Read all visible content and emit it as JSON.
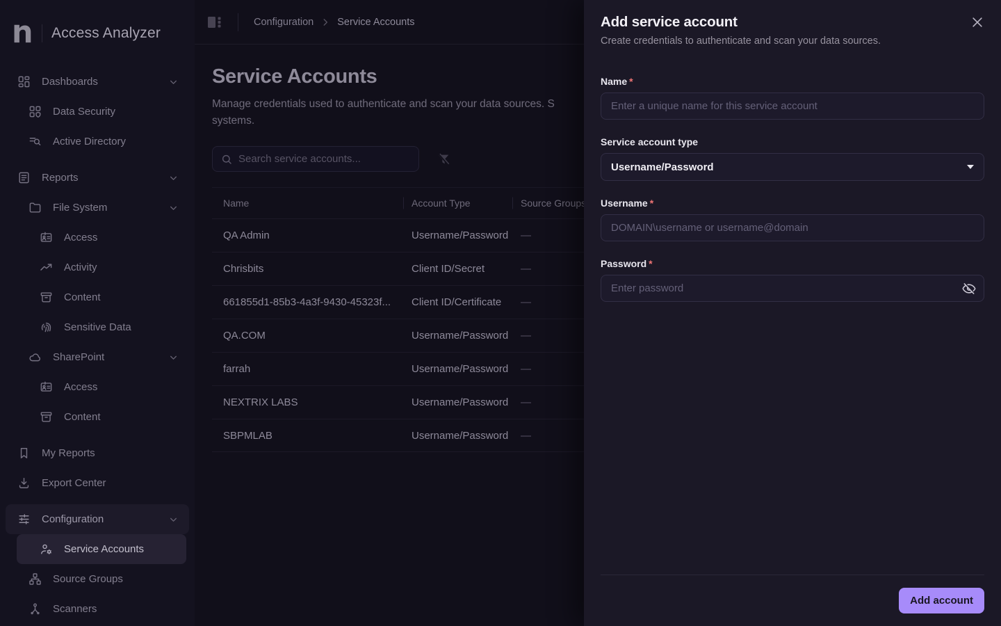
{
  "brand": {
    "name": "Access Analyzer"
  },
  "sidebar": {
    "items": [
      {
        "label": "Dashboards",
        "icon": "dashboard",
        "level": 0,
        "expandable": true
      },
      {
        "label": "Data Security",
        "icon": "data-security",
        "level": 1
      },
      {
        "label": "Active Directory",
        "icon": "active-directory",
        "level": 1
      },
      {
        "label": "Reports",
        "icon": "reports",
        "level": 0,
        "expandable": true,
        "gap": true
      },
      {
        "label": "File System",
        "icon": "folder",
        "level": 1,
        "expandable": true
      },
      {
        "label": "Access",
        "icon": "badge",
        "level": 2
      },
      {
        "label": "Activity",
        "icon": "activity",
        "level": 2
      },
      {
        "label": "Content",
        "icon": "archive",
        "level": 2
      },
      {
        "label": "Sensitive Data",
        "icon": "fingerprint",
        "level": 2
      },
      {
        "label": "SharePoint",
        "icon": "cloud",
        "level": 1,
        "expandable": true
      },
      {
        "label": "Access",
        "icon": "badge",
        "level": 2
      },
      {
        "label": "Content",
        "icon": "archive",
        "level": 2
      },
      {
        "label": "My Reports",
        "icon": "bookmark",
        "level": 0,
        "gap": true
      },
      {
        "label": "Export Center",
        "icon": "download",
        "level": 0
      },
      {
        "label": "Configuration",
        "icon": "sliders",
        "level": 0,
        "expandable": true,
        "active": true,
        "gap": true
      },
      {
        "label": "Service Accounts",
        "icon": "user-gear",
        "level": 1,
        "selected": true
      },
      {
        "label": "Source Groups",
        "icon": "network",
        "level": 1
      },
      {
        "label": "Scanners",
        "icon": "scanner",
        "level": 1
      }
    ]
  },
  "header": {
    "breadcrumb": [
      "Configuration",
      "Service Accounts"
    ]
  },
  "main": {
    "title": "Service Accounts",
    "description_line1": "Manage credentials used to authenticate and scan your data sources. S",
    "description_line2": "systems.",
    "search_placeholder": "Search service accounts...",
    "table": {
      "columns": [
        "Name",
        "Account Type",
        "Source Groups"
      ],
      "rows": [
        {
          "name": "QA Admin",
          "type": "Username/Password",
          "source": "—"
        },
        {
          "name": "Chrisbits",
          "type": "Client ID/Secret",
          "source": "—"
        },
        {
          "name": "661855d1-85b3-4a3f-9430-45323f...",
          "type": "Client ID/Certificate",
          "source": "—"
        },
        {
          "name": "QA.COM",
          "type": "Username/Password",
          "source": "—"
        },
        {
          "name": "farrah",
          "type": "Username/Password",
          "source": "—"
        },
        {
          "name": "NEXTRIX LABS",
          "type": "Username/Password",
          "source": "—"
        },
        {
          "name": "SBPMLAB",
          "type": "Username/Password",
          "source": "—"
        }
      ]
    }
  },
  "drawer": {
    "title": "Add service account",
    "subtitle": "Create credentials to authenticate and scan your data sources.",
    "required_marker": "*",
    "fields": {
      "name": {
        "label": "Name",
        "placeholder": "Enter a unique name for this service account"
      },
      "type": {
        "label": "Service account type",
        "value": "Username/Password"
      },
      "username": {
        "label": "Username",
        "placeholder": "DOMAIN\\username or username@domain"
      },
      "password": {
        "label": "Password",
        "placeholder": "Enter password"
      }
    },
    "submit_label": "Add account"
  },
  "colors": {
    "accent": "#a78bfa",
    "required_star": "#f07575",
    "drawer_bg": "#1b1826",
    "page_bg": "#110f1a",
    "sidebar_bg": "#14121f"
  }
}
